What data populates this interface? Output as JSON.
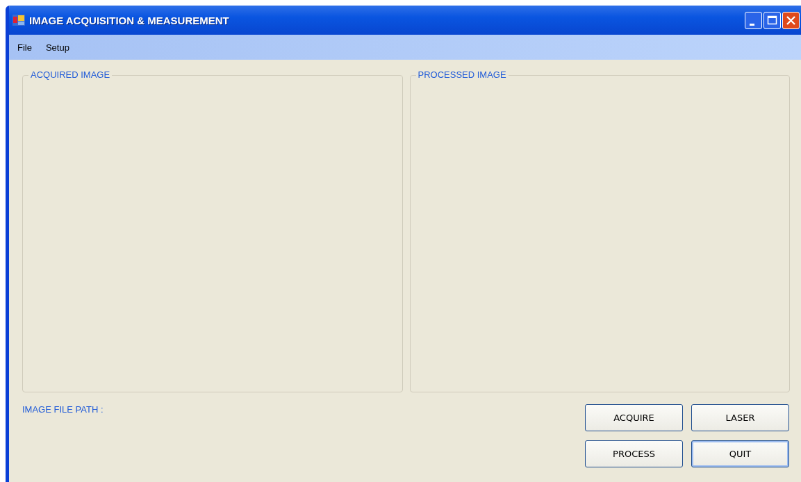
{
  "window": {
    "title": "IMAGE ACQUISITION & MEASUREMENT"
  },
  "menu": [
    "File",
    "Setup"
  ],
  "groups": [
    {
      "title": "ACQUIRED IMAGE"
    },
    {
      "title": "PROCESSED IMAGE"
    }
  ],
  "file_path_label": "IMAGE FILE PATH :",
  "buttons": [
    {
      "label": "ACQUIRE",
      "default": false
    },
    {
      "label": "LASER",
      "default": false
    },
    {
      "label": "PROCESS",
      "default": false
    },
    {
      "label": "QUIT",
      "default": true
    }
  ]
}
